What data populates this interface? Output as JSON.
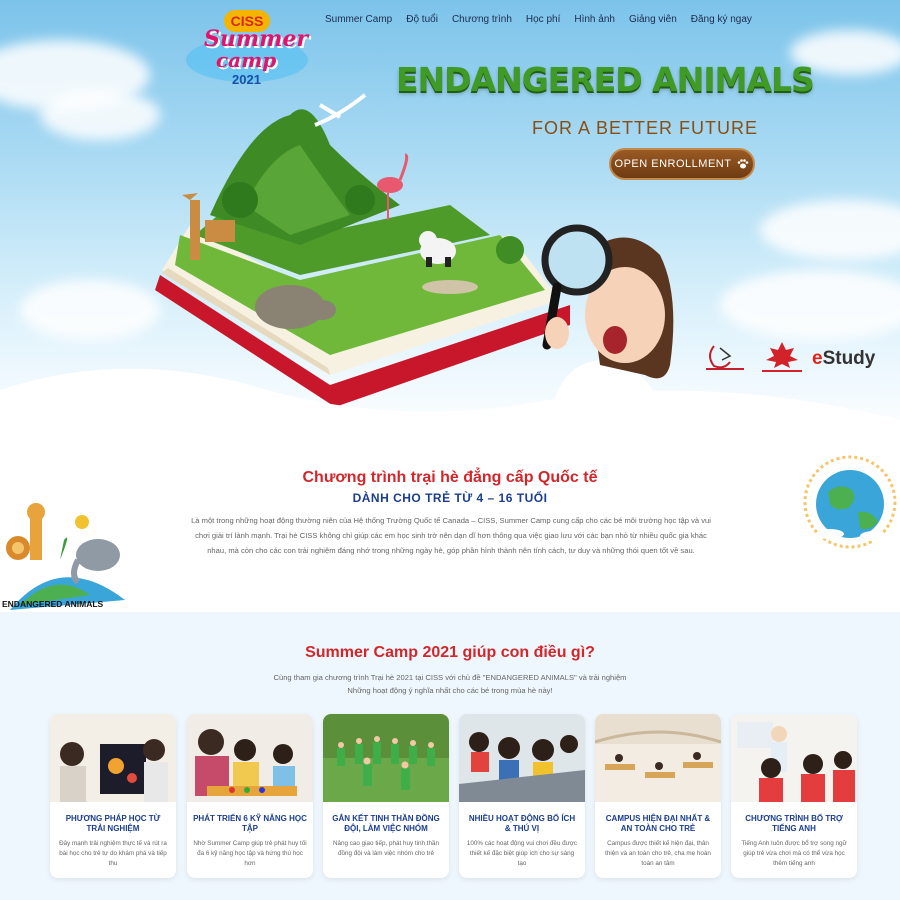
{
  "nav": {
    "items": [
      "Summer Camp",
      "Độ tuổi",
      "Chương trình",
      "Học phí",
      "Hình ảnh",
      "Giảng viên",
      "Đăng ký ngay"
    ]
  },
  "logo": {
    "badge": "CISS",
    "line1": "Summer",
    "line2": "camp",
    "year": "2021"
  },
  "hero": {
    "title": "ENDANGERED ANIMALS",
    "subtitle": "FOR A BETTER FUTURE",
    "button_label": "OPEN ENROLLMENT",
    "button_icon": "paw-icon"
  },
  "partners": {
    "brand_e": "e",
    "brand_rest": "Study"
  },
  "intro": {
    "title": "Chương trình trại hè đẳng cấp Quốc tế",
    "subtitle": "DÀNH CHO TRẺ TỪ 4 – 16 TUỔI",
    "text": "Là một trong những hoạt động thường niên của Hệ thống Trường Quốc tế Canada – CISS, Summer Camp cung cấp cho các bé môi trường học tập và vui chơi giải trí lành mạnh. Trại hè CISS không chỉ giúp các em học sinh trở nên dạn dĩ hơn thông qua việc giao lưu với các bạn nhỏ từ nhiều quốc gia khác nhau, mà còn cho các con trải nghiệm đáng nhớ trong những ngày hè, góp phần hình thành nên tính cách, tư duy và những thói quen tốt về sau.",
    "animals_caption": "ENDANGERED ANIMALS"
  },
  "benefits": {
    "title": "Summer Camp 2021 giúp con điều gì?",
    "desc_line1": "Cùng tham gia chương trình Trại hè 2021 tại CISS với chủ đề \"ENDANGERED ANIMALS\" và trải nghiệm",
    "desc_line2": "Những hoạt động ý nghĩa nhất cho các bé trong mùa hè này!",
    "cards": [
      {
        "title": "PHƯƠNG PHÁP HỌC TỪ TRẢI NGHIỆM",
        "text": "Đây mạnh trải nghiệm thực tế và rút ra bài học cho trẻ tự do khám phá và tiếp thu"
      },
      {
        "title": "PHÁT TRIỂN 6 KỸ NĂNG HỌC TẬP",
        "text": "Nhờ Summer Camp giúp trẻ phát huy tối đa 6 kỹ năng học tập và hứng thú học hơn"
      },
      {
        "title": "GẮN KẾT TINH THẦN ĐỒNG ĐỘI, LÀM VIỆC NHÓM",
        "text": "Nâng cao giao tiếp, phát huy tinh thần đồng đội và làm việc nhóm cho trẻ"
      },
      {
        "title": "NHIỀU HOẠT ĐỘNG BỔ ÍCH & THÚ VỊ",
        "text": "100% các hoạt động vui chơi đều được thiết kế đặc biệt giúp ích cho sự sáng tạo"
      },
      {
        "title": "CAMPUS HIỆN ĐẠI NHẤT & AN TOÀN CHO TRẺ",
        "text": "Campus được thiết kế hiện đại, thân thiện và an toàn cho trẻ, cha mẹ hoàn toàn an tâm"
      },
      {
        "title": "CHƯƠNG TRÌNH BỔ TRỢ TIẾNG ANH",
        "text": "Tiếng Anh luôn được bổ trợ song ngữ giúp trẻ vừa chơi mà có thể vừa học thêm tiếng anh"
      }
    ]
  }
}
